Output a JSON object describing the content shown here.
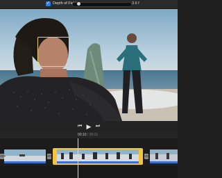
{
  "toolbar": {
    "depth_of_field_label": "Depth of Field",
    "depth_of_field_value": "3.6 f",
    "depth_of_field_enabled": true,
    "depth_of_field_slider_position": 0.08,
    "checkbox_glyph": "✓",
    "accent_color": "#2f7fe0"
  },
  "transport": {
    "rewind_glyph": "⏮",
    "play_glyph": "▶",
    "forward_glyph": "⏭"
  },
  "timeline": {
    "current_time": "00:10",
    "total_time": "00:21",
    "separator": "/",
    "selected_clip_border_color": "#f2c53d",
    "transition_glyph": "⊲⊳"
  },
  "viewer": {
    "focus_indicator_color": "#e8d27a"
  }
}
